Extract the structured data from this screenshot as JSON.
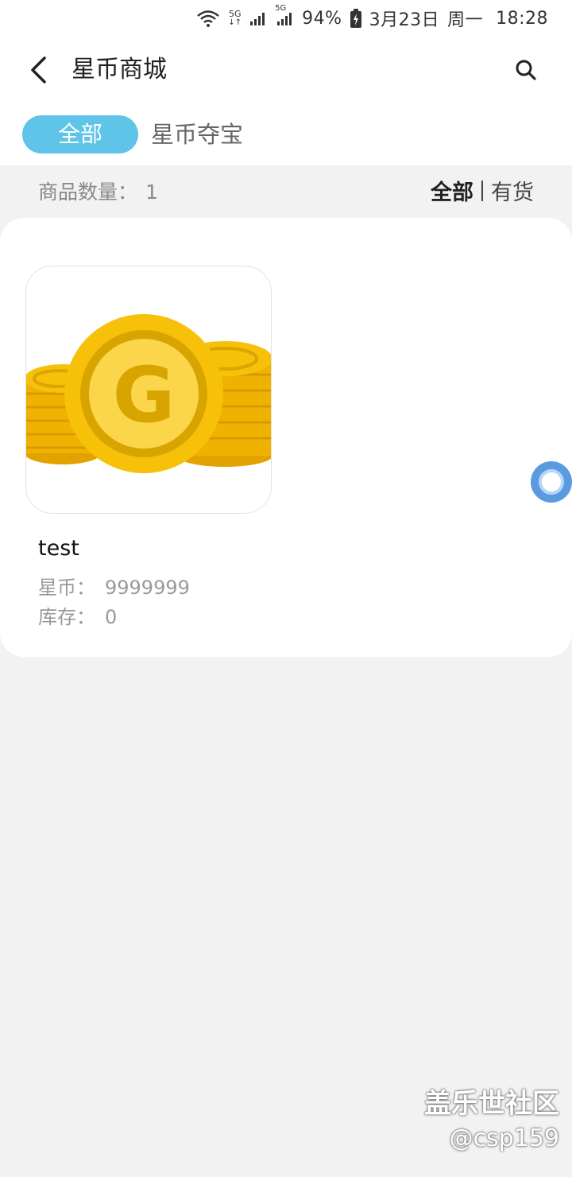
{
  "status_bar": {
    "battery": "94%",
    "date": "3月23日",
    "weekday": "周一",
    "time": "18:28",
    "signal_a": "5G",
    "signal_b": "5G"
  },
  "header": {
    "title": "星币商城",
    "back_icon": "chevron-left-icon",
    "search_icon": "search-icon"
  },
  "tabs": [
    {
      "label": "全部",
      "active": true
    },
    {
      "label": "星币夺宝",
      "active": false
    }
  ],
  "summary": {
    "count_label": "商品数量：",
    "count_value": "1",
    "filter_all": "全部",
    "filter_in_stock": "有货"
  },
  "products": [
    {
      "name": "test",
      "price_label": "星币：",
      "price_value": "9999999",
      "stock_label": "库存：",
      "stock_value": "0",
      "image_icon": "gold-coin-icon"
    }
  ],
  "watermark": {
    "line1": "盖乐世社区",
    "line2": "@csp159"
  },
  "colors": {
    "accent": "#5ec4e8",
    "coin_gold": "#f6c108",
    "float_button": "#5a9be0"
  }
}
